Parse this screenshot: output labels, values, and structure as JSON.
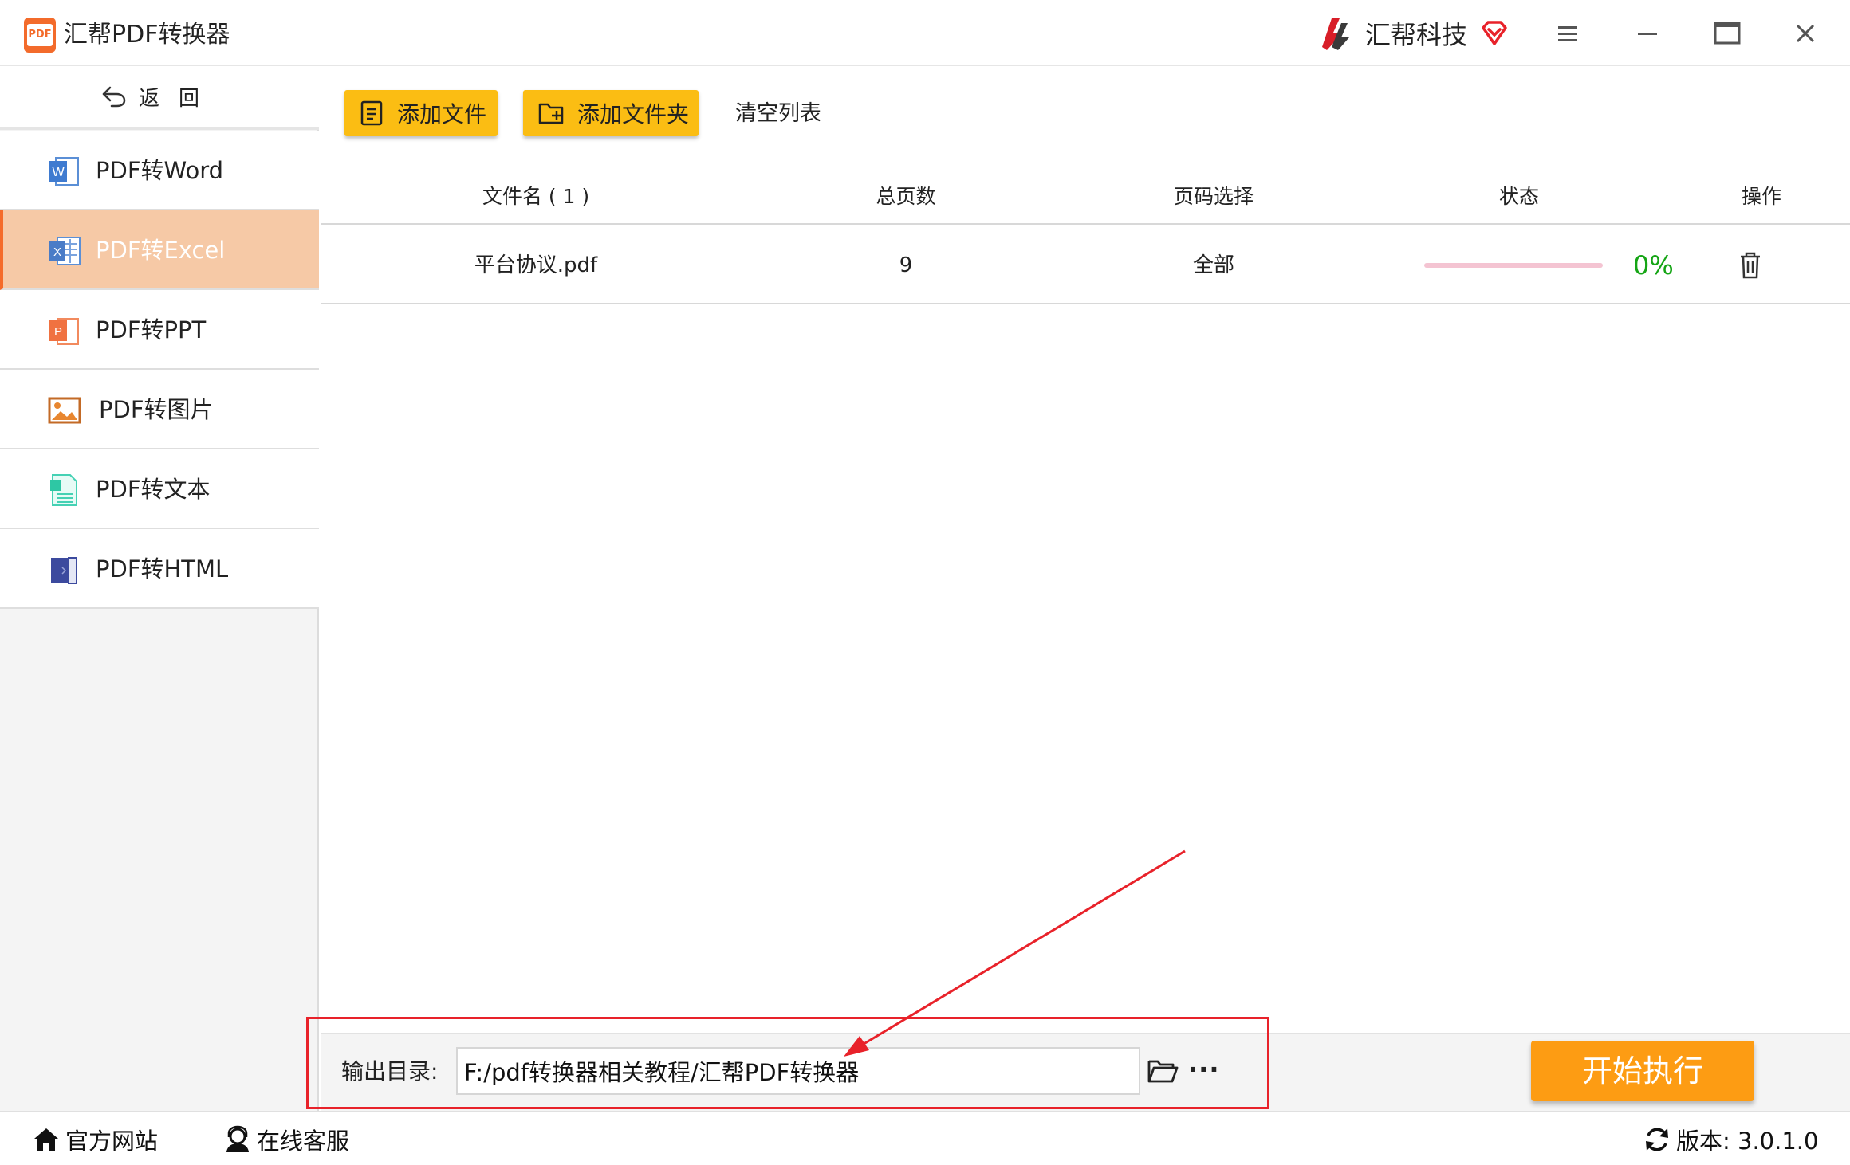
{
  "titlebar": {
    "app_title": "汇帮PDF转换器",
    "app_logo_text": "PDF",
    "brand_name": "汇帮科技"
  },
  "sidebar": {
    "back_label": "返回",
    "items": [
      {
        "label": "PDF转Word",
        "icon": "word-icon",
        "active": false
      },
      {
        "label": "PDF转Excel",
        "icon": "excel-icon",
        "active": true
      },
      {
        "label": "PDF转PPT",
        "icon": "ppt-icon",
        "active": false
      },
      {
        "label": "PDF转图片",
        "icon": "image-icon",
        "active": false
      },
      {
        "label": "PDF转文本",
        "icon": "text-icon",
        "active": false
      },
      {
        "label": "PDF转HTML",
        "icon": "html-icon",
        "active": false
      }
    ]
  },
  "toolbar": {
    "add_file": "添加文件",
    "add_folder": "添加文件夹",
    "clear_list": "清空列表"
  },
  "table": {
    "headers": {
      "filename": "文件名 ( 1 )",
      "pages": "总页数",
      "page_select": "页码选择",
      "status": "状态",
      "action": "操作"
    },
    "rows": [
      {
        "filename": "平台协议.pdf",
        "pages": "9",
        "page_select": "全部",
        "progress": 0,
        "progress_text": "0%"
      }
    ]
  },
  "output": {
    "label": "输出目录:",
    "path": "F:/pdf转换器相关教程/汇帮PDF转换器",
    "more": "···"
  },
  "start_button": "开始执行",
  "statusbar": {
    "website": "官方网站",
    "support": "在线客服",
    "version": "版本: 3.0.1.0"
  },
  "colors": {
    "accent_orange": "#fd9c13",
    "toolbar_yellow": "#fbbd13",
    "active_nav": "#f6c9a6",
    "progress_green": "#15a515",
    "annotation_red": "#e8222a"
  }
}
